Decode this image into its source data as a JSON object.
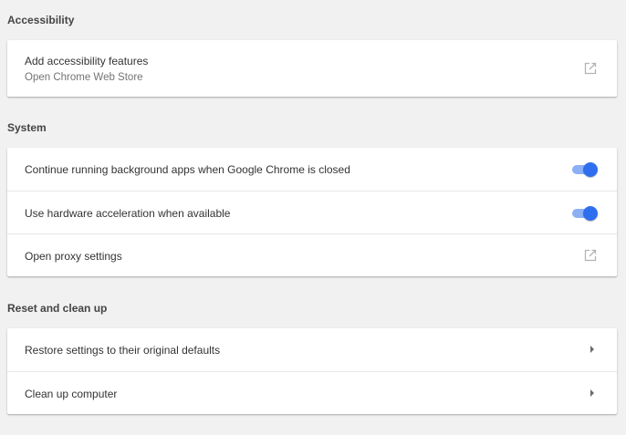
{
  "sections": {
    "accessibility": {
      "title": "Accessibility",
      "item": {
        "label": "Add accessibility features",
        "sublabel": "Open Chrome Web Store",
        "icon": "open-in-new-icon"
      }
    },
    "system": {
      "title": "System",
      "items": [
        {
          "label": "Continue running background apps when Google Chrome is closed",
          "control": "toggle",
          "checked": true
        },
        {
          "label": "Use hardware acceleration when available",
          "control": "toggle",
          "checked": true
        },
        {
          "label": "Open proxy settings",
          "control": "open-in-new-icon"
        }
      ]
    },
    "reset": {
      "title": "Reset and clean up",
      "items": [
        {
          "label": "Restore settings to their original defaults",
          "control": "arrow-right-icon"
        },
        {
          "label": "Clean up computer",
          "control": "arrow-right-icon"
        }
      ]
    }
  },
  "colors": {
    "background": "#f1f1f1",
    "toggle_track": "#8cb0f5",
    "toggle_knob": "#2f6fef",
    "icon_gray": "#b3b3b3"
  }
}
